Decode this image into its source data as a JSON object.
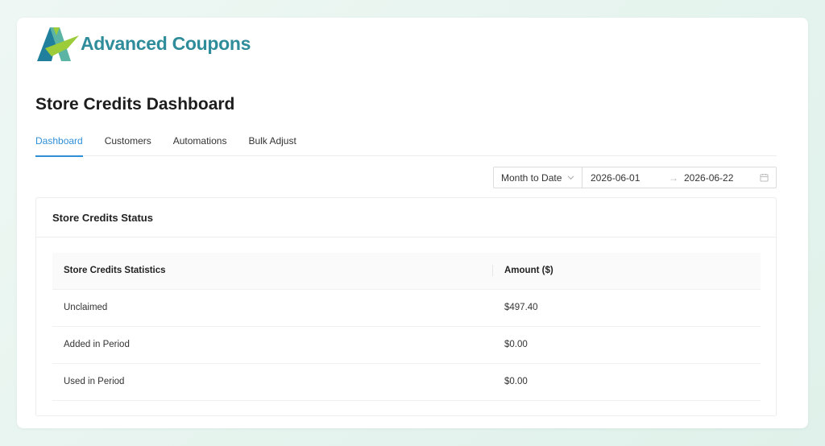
{
  "brand": {
    "name": "Advanced Coupons",
    "color": "#2f8c9a",
    "logo_colors": [
      "#1f7f9c",
      "#9ccc3a",
      "#5cb4a4"
    ]
  },
  "page": {
    "title": "Store Credits Dashboard"
  },
  "tabs": [
    {
      "label": "Dashboard",
      "active": true
    },
    {
      "label": "Customers",
      "active": false
    },
    {
      "label": "Automations",
      "active": false
    },
    {
      "label": "Bulk Adjust",
      "active": false
    }
  ],
  "filter": {
    "period": "Month to Date",
    "start_date": "2026-06-01",
    "end_date": "2026-06-22",
    "separator": "→",
    "icons": {
      "dropdown": "chevron-down-icon",
      "calendar": "calendar-icon"
    }
  },
  "status_panel": {
    "title": "Store Credits Status",
    "columns": [
      "Store Credits Statistics",
      "Amount ($)"
    ],
    "rows": [
      {
        "label": "Unclaimed",
        "amount": "$497.40"
      },
      {
        "label": "Added in Period",
        "amount": "$0.00"
      },
      {
        "label": "Used in Period",
        "amount": "$0.00"
      }
    ]
  },
  "accent_color": "#2f8fd6"
}
